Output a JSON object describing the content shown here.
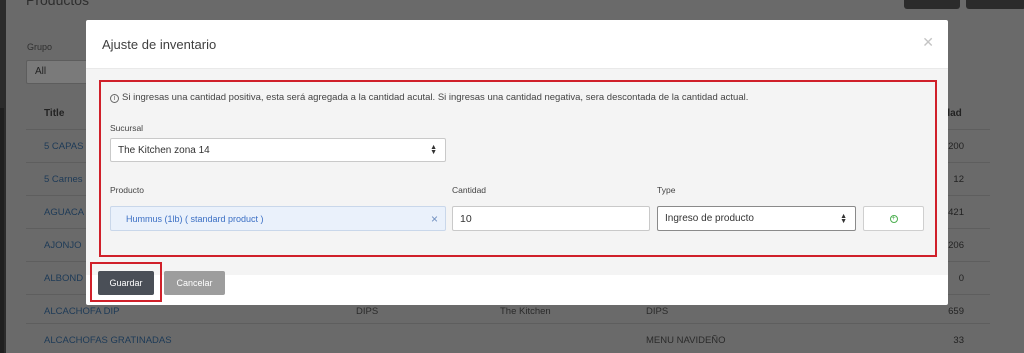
{
  "background": {
    "page_title": "Productos",
    "filter": {
      "label": "Grupo",
      "value": "All"
    },
    "table": {
      "headers": {
        "title": "Title",
        "quantity": "dad"
      },
      "rows": [
        {
          "title": "5 CAPAS",
          "group": "",
          "branch": "",
          "category": "",
          "qty": "200"
        },
        {
          "title": "5 Carnes",
          "group": "",
          "branch": "",
          "category": "",
          "qty": "12"
        },
        {
          "title": "AGUACA",
          "group": "",
          "branch": "",
          "category": "",
          "qty": "421"
        },
        {
          "title": "AJONJO",
          "group": "",
          "branch": "",
          "category": "",
          "qty": "206"
        },
        {
          "title": "ALBOND",
          "group": "",
          "branch": "",
          "category": "",
          "qty": "0"
        },
        {
          "title": "ALCACHOFA DIP",
          "group": "DIPS",
          "branch": "The Kitchen",
          "category": "DIPS",
          "qty": "659"
        },
        {
          "title": "ALCACHOFAS GRATINADAS",
          "group": "",
          "branch": "",
          "category": "MENU NAVIDEÑO",
          "qty": "33"
        }
      ]
    }
  },
  "modal": {
    "title": "Ajuste de inventario",
    "close_icon": "close-icon",
    "info_text": "Si ingresas una cantidad positiva, esta será agregada a la cantidad acutal. Si ingresas una cantidad negativa, sera descontada de la cantidad actual.",
    "sucursal": {
      "label": "Sucursal",
      "value": "The Kitchen zona 14"
    },
    "producto": {
      "label": "Producto",
      "value": "Hummus (1lb) ( standard product )"
    },
    "cantidad": {
      "label": "Cantidad",
      "value": "10"
    },
    "type": {
      "label": "Type",
      "value": "Ingreso de producto"
    },
    "add_icon": "plus-circle-icon",
    "buttons": {
      "save": "Guardar",
      "cancel": "Cancelar"
    }
  },
  "colors": {
    "highlight": "#d0202a",
    "save_button": "#4a4f57",
    "cancel_button": "#9d9d9d",
    "product_tag_text": "#3b6fc4",
    "add_icon": "#4caf50"
  }
}
